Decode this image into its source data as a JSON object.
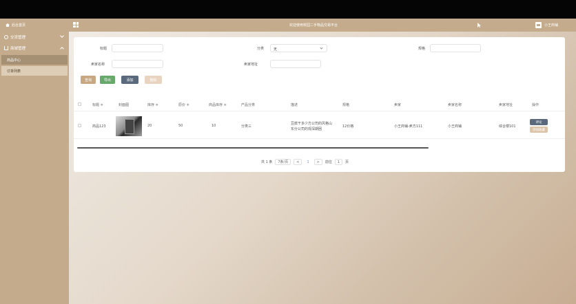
{
  "header": {
    "brand": "后台首页",
    "welcome": "欢迎使用校园二手物品交易平台",
    "username": "小王商铺"
  },
  "sidebar": {
    "groups": [
      {
        "label": "交流管理",
        "icon": "chat-icon",
        "expanded": false
      },
      {
        "label": "商城管理",
        "icon": "bag-icon",
        "expanded": true
      }
    ],
    "items": [
      {
        "label": "商品中心",
        "active": true
      },
      {
        "label": "订单列表",
        "active": false
      }
    ]
  },
  "filters": {
    "title_label": "标题",
    "category_label": "分类",
    "category_value": "无",
    "spec_label": "规格",
    "seller_label": "卖家名称",
    "address_label": "卖家地址"
  },
  "buttons": {
    "search": "查询",
    "export": "导出",
    "add": "添加",
    "delete": "删除"
  },
  "table": {
    "headers": [
      "标题 ≑",
      "封面图",
      "库存 ≑",
      "原价 ≑",
      "商品库存 ≑",
      "产品分类",
      "描述",
      "规格",
      "卖家",
      "卖家名称",
      "卖家地址",
      "操作"
    ],
    "rows": [
      {
        "title": "商品123",
        "stock": "20",
        "price": "50",
        "goods_stock": "10",
        "category": "分类三",
        "desc_line1": "豆腐干多少方公司的风格山",
        "desc_line2": "东分公司的观深期困",
        "spec": "12价格",
        "seller": "小王商铺-卖方111",
        "seller_name": "小王商铺",
        "seller_address": "综合楼101",
        "op_review": "评论",
        "op_fav": "添加收藏"
      }
    ]
  },
  "pagination": {
    "total": "共 1 条",
    "page_size": "7条/页",
    "prev": "<",
    "current": "1",
    "next": ">",
    "goto_label": "前往",
    "goto_value": "1",
    "page_suffix": "页"
  }
}
